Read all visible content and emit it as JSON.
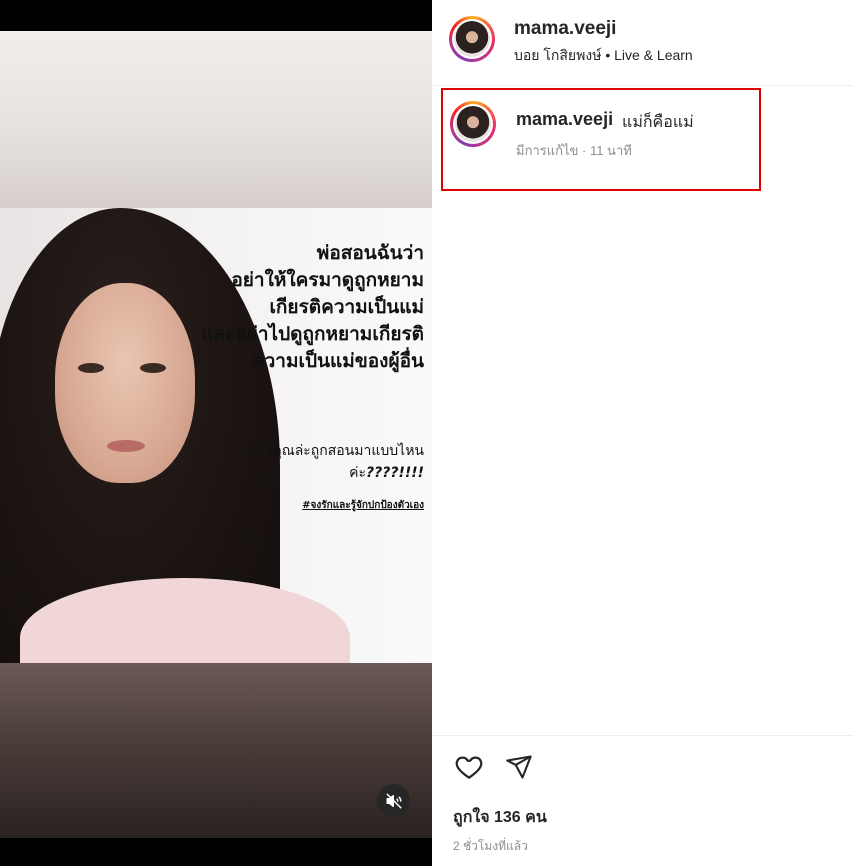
{
  "post": {
    "overlay_lines": [
      "พ่อสอนฉันว่า",
      "อย่าให้ใครมาดูถูกหยาม",
      "เกียรติความเป็นแม่",
      "และอย่าไปดูถูกหยามเกียรติ",
      "ความเป็นแม่ของผู้อื่น"
    ],
    "overlay_question_line1": "แล้วคุณล่ะถูกสอนมาแบบไหน",
    "overlay_question_prefix": "ค่ะ",
    "overlay_question_emphasis": "????!!!!",
    "overlay_hashtag": "#จงรักและรู้จักปกป้องตัวเอง",
    "mute_icon": "speaker-muted-icon"
  },
  "header": {
    "username": "mama.veeji",
    "subtitle": "บอย โกสิยพงษ์ • Live & Learn"
  },
  "caption": {
    "username": "mama.veeji",
    "text": "แม่ก็คือแม่",
    "meta": "มีการแก้ไข · 11 นาที"
  },
  "actions": {
    "like_icon": "heart-icon",
    "share_icon": "send-icon",
    "likes_text": "ถูกใจ 136 คน",
    "time_ago": "2 ชั่วโมงที่แล้ว"
  },
  "colors": {
    "highlight_border": "#e00000",
    "muted_text": "#8e8e8e"
  }
}
